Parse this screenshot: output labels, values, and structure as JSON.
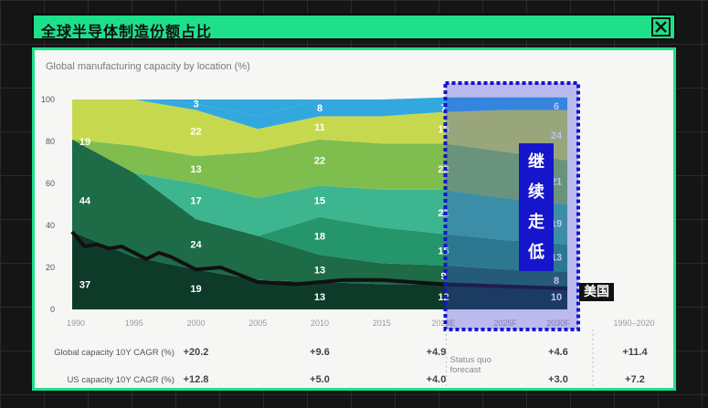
{
  "window": {
    "title": "全球半导体制造份额占比",
    "close_icon": "close-icon"
  },
  "colors": {
    "accent": "#1fe08a",
    "highlight": "#1515cc",
    "line": "#111111"
  },
  "callouts": {
    "vertical_text": [
      "继",
      "续",
      "走",
      "低"
    ],
    "us_label": "美国",
    "status_quo": [
      "Status quo",
      "forecast"
    ]
  },
  "chart_data": {
    "type": "area",
    "title": "Global manufacturing capacity by location (%)",
    "xlabel": "",
    "ylabel": "",
    "ylim": [
      0,
      100
    ],
    "y_ticks": [
      "0",
      "20",
      "40",
      "60",
      "80",
      "100"
    ],
    "x": [
      1990,
      1995,
      2000,
      2005,
      2010,
      2015,
      2020,
      2025,
      2030
    ],
    "x_tick_labels": [
      "1990",
      "1995",
      "2000",
      "2005",
      "2010",
      "2015",
      "2020E",
      "2025F",
      "2030F"
    ],
    "extra_x_label": "1990–2020",
    "series": [
      {
        "color": "#0e3b29",
        "values": [
          37,
          25,
          19,
          14,
          13,
          12,
          12,
          11,
          10
        ]
      },
      {
        "color": "#1d6b47",
        "values": [
          44,
          40,
          24,
          21,
          13,
          10,
          9,
          8,
          8
        ]
      },
      {
        "color": "#25956c",
        "values": [
          0,
          0,
          0,
          0,
          18,
          17,
          15,
          14,
          13
        ]
      },
      {
        "color": "#3db58f",
        "values": [
          0,
          0,
          17,
          18,
          15,
          18,
          21,
          20,
          19
        ]
      },
      {
        "color": "#7fbd4f",
        "values": [
          0,
          13,
          13,
          22,
          22,
          22,
          22,
          22,
          21
        ]
      },
      {
        "color": "#c6d94e",
        "values": [
          19,
          22,
          22,
          11,
          11,
          13,
          15,
          20,
          24
        ]
      },
      {
        "color": "#e8e74a",
        "values": [
          0,
          0,
          0,
          0,
          0,
          0,
          0,
          0,
          0
        ]
      },
      {
        "color": "#33a8df",
        "values": [
          0,
          0,
          3,
          6,
          8,
          8,
          7,
          6,
          6
        ]
      }
    ],
    "data_labels": [
      {
        "x": 1990,
        "y": 12,
        "text": "37"
      },
      {
        "x": 1990,
        "y": 52,
        "text": "44"
      },
      {
        "x": 1990,
        "y": 80,
        "text": "19"
      },
      {
        "x": 2000,
        "y": 10,
        "text": "19"
      },
      {
        "x": 2000,
        "y": 31,
        "text": "24"
      },
      {
        "x": 2000,
        "y": 52,
        "text": "17"
      },
      {
        "x": 2000,
        "y": 67,
        "text": "13"
      },
      {
        "x": 2000,
        "y": 85,
        "text": "22"
      },
      {
        "x": 2000,
        "y": 98,
        "text": "3"
      },
      {
        "x": 2010,
        "y": 6,
        "text": "13"
      },
      {
        "x": 2010,
        "y": 19,
        "text": "13"
      },
      {
        "x": 2010,
        "y": 35,
        "text": "18"
      },
      {
        "x": 2010,
        "y": 52,
        "text": "15"
      },
      {
        "x": 2010,
        "y": 71,
        "text": "22"
      },
      {
        "x": 2010,
        "y": 87,
        "text": "11"
      },
      {
        "x": 2010,
        "y": 96,
        "text": "8"
      },
      {
        "x": 2020,
        "y": 6,
        "text": "12"
      },
      {
        "x": 2020,
        "y": 16,
        "text": "9"
      },
      {
        "x": 2020,
        "y": 28,
        "text": "15"
      },
      {
        "x": 2020,
        "y": 46,
        "text": "21"
      },
      {
        "x": 2020,
        "y": 67,
        "text": "22"
      },
      {
        "x": 2020,
        "y": 86,
        "text": "15"
      },
      {
        "x": 2020,
        "y": 96,
        "text": "7"
      },
      {
        "x": 2030,
        "y": 6,
        "text": "10"
      },
      {
        "x": 2030,
        "y": 14,
        "text": "8"
      },
      {
        "x": 2030,
        "y": 25,
        "text": "13"
      },
      {
        "x": 2030,
        "y": 41,
        "text": "19"
      },
      {
        "x": 2030,
        "y": 61,
        "text": "21"
      },
      {
        "x": 2030,
        "y": 83,
        "text": "24"
      },
      {
        "x": 2030,
        "y": 97,
        "text": "6"
      }
    ],
    "us_line": {
      "x": [
        1990,
        1991,
        1992,
        1993,
        1994,
        1995,
        1996,
        1997,
        1998,
        2000,
        2002,
        2005,
        2008,
        2010,
        2012,
        2015,
        2020,
        2025,
        2030
      ],
      "y": [
        37,
        30,
        31,
        29,
        30,
        27,
        24,
        27,
        25,
        19,
        20,
        13,
        12,
        13,
        14,
        14,
        12,
        11,
        10
      ]
    },
    "table": {
      "rows": [
        {
          "label": "Global capacity 10Y CAGR (%)",
          "values": [
            "+20.2",
            "+9.6",
            "+4.9",
            "+4.6",
            "+11.4"
          ]
        },
        {
          "label": "US capacity 10Y CAGR (%)",
          "values": [
            "+12.8",
            "+5.0",
            "+4.0",
            "+3.0",
            "+7.2"
          ]
        }
      ]
    }
  }
}
